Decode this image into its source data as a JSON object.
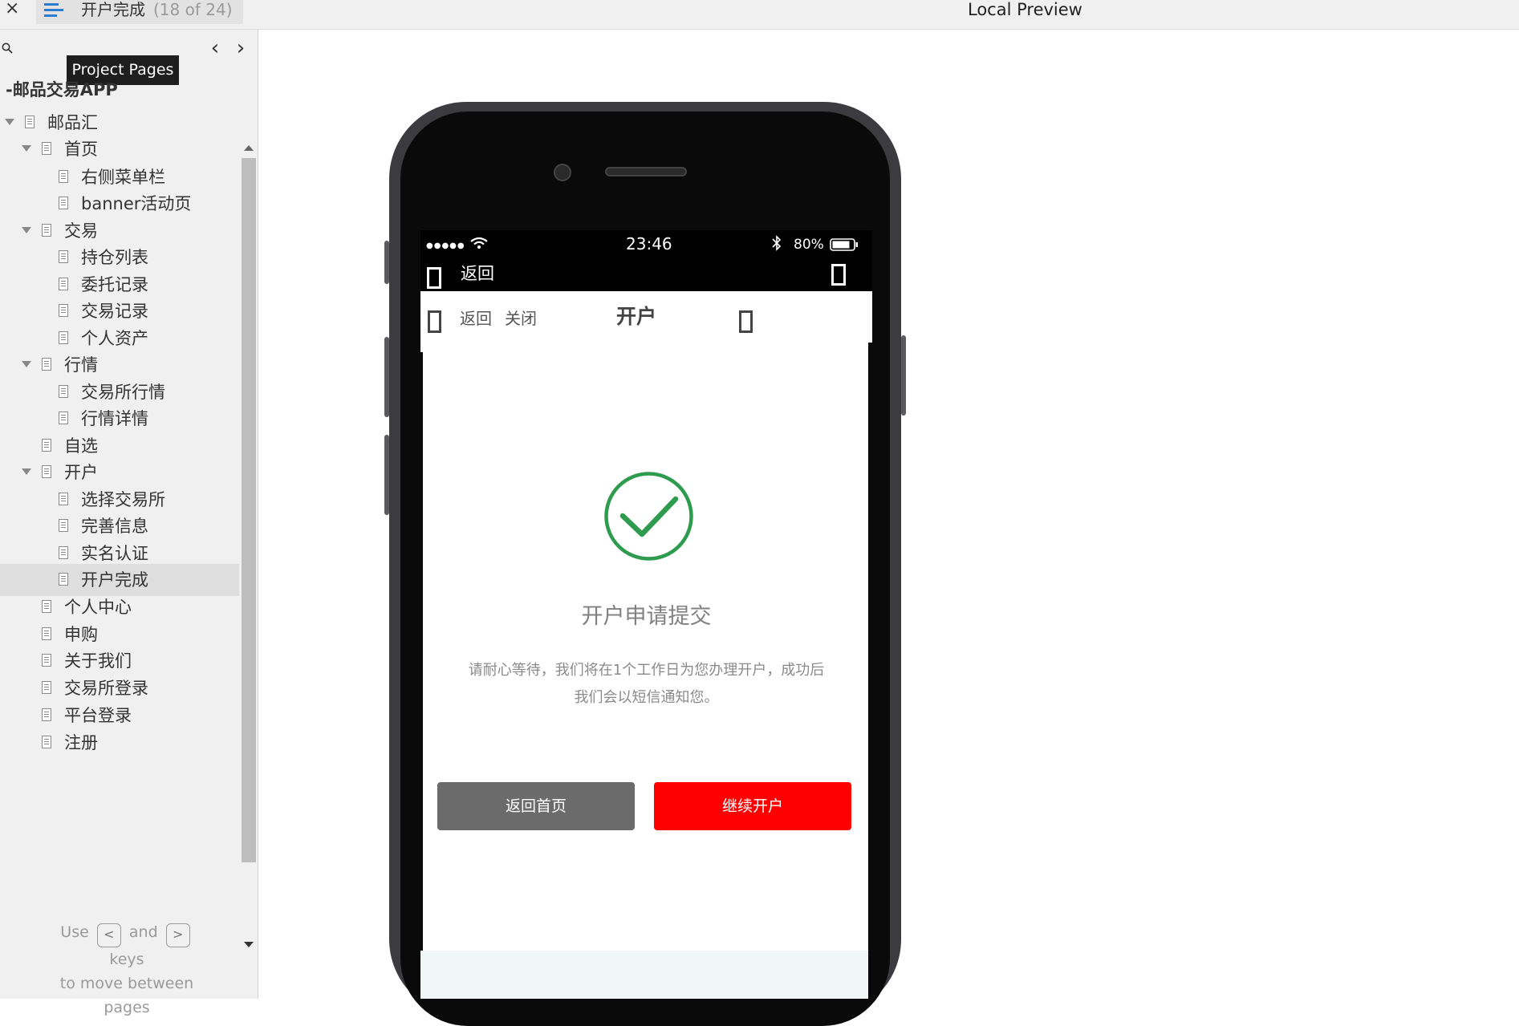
{
  "topbar": {
    "close_glyph": "×",
    "page_title": "开户完成",
    "page_count": "(18 of 24)",
    "preview_title": "Local Preview"
  },
  "sidebar": {
    "tooltip": "Project Pages",
    "prev_glyph": "‹",
    "next_glyph": "›",
    "project_title": "-邮品交易APP",
    "selected_label": "开户完成",
    "items": [
      {
        "label": "邮品汇"
      },
      {
        "label": "首页"
      },
      {
        "label": "右侧菜单栏"
      },
      {
        "label": "banner活动页"
      },
      {
        "label": "交易"
      },
      {
        "label": "持仓列表"
      },
      {
        "label": "委托记录"
      },
      {
        "label": "交易记录"
      },
      {
        "label": "个人资产"
      },
      {
        "label": "行情"
      },
      {
        "label": "交易所行情"
      },
      {
        "label": "行情详情"
      },
      {
        "label": "自选"
      },
      {
        "label": "开户"
      },
      {
        "label": "选择交易所"
      },
      {
        "label": "完善信息"
      },
      {
        "label": "实名认证"
      },
      {
        "label": "开户完成"
      },
      {
        "label": "个人中心"
      },
      {
        "label": "申购"
      },
      {
        "label": "关于我们"
      },
      {
        "label": "交易所登录"
      },
      {
        "label": "平台登录"
      },
      {
        "label": "注册"
      }
    ],
    "help": {
      "use": "Use",
      "key_left": "<",
      "and": "and",
      "key_right": ">",
      "keys": "keys",
      "line2": "to move between",
      "line3": "pages"
    }
  },
  "phone": {
    "status": {
      "signal": "●●●●●",
      "time": "23:46",
      "battery": "80%"
    },
    "appbar_back": "返回",
    "nav": {
      "back": "返回",
      "close": "关闭",
      "title": "开户"
    },
    "result": {
      "title": "开户申请提交",
      "desc_line1": "请耐心等待，我们将在1个工作日为您办理开户，成功后",
      "desc_line2": "我们会以短信通知您。"
    },
    "buttons": {
      "home": "返回首页",
      "continue": "继续开户"
    },
    "colors": {
      "success_green": "#2e9b4e",
      "primary_red": "#ff0000",
      "secondary_gray": "#6b6b6b"
    }
  }
}
